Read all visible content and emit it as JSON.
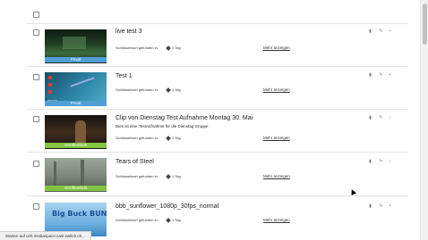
{
  "keyword_label": "Schlüsselwort gefunden in:",
  "more_label": "Mehr anzeigen",
  "status_text": "Warten auf uzh.mediaspace.cast.switch.ch...",
  "entries": [
    {
      "title": "live test 3",
      "description": "",
      "tag": "1 Tag",
      "duration": "15:06",
      "badge": "Privat",
      "badge_type": "private",
      "thumb_color": "#274a2b"
    },
    {
      "title": "Test 1",
      "description": "",
      "tag": "1 Tag",
      "duration": "00:01",
      "badge": "Privat",
      "badge_type": "private",
      "thumb_color": "#2d6b86"
    },
    {
      "title": "Clip von Dienstag Test Aufnahme Montag 30. Mai",
      "description": "Dies ist eine TestAufnahme für die Dienstag Gruppe",
      "tag": "1 Tag",
      "duration": "01:47:46",
      "badge": "Veröffentlicht",
      "badge_type": "public",
      "thumb_color": "#3a2a1c"
    },
    {
      "title": "Tears of Steel",
      "description": "",
      "tag": "1 Tag",
      "duration": "12:14",
      "badge": "Veröffentlicht",
      "badge_type": "public",
      "thumb_color": "#707d6d"
    },
    {
      "title": "bbb_sunflower_1080p_30fps_normal",
      "description": "",
      "tag": "1 Tag",
      "duration": "",
      "badge": "",
      "badge_type": "",
      "thumb_color": "#5b95d0",
      "thumb_text": "Big Buck BUNNY"
    }
  ]
}
